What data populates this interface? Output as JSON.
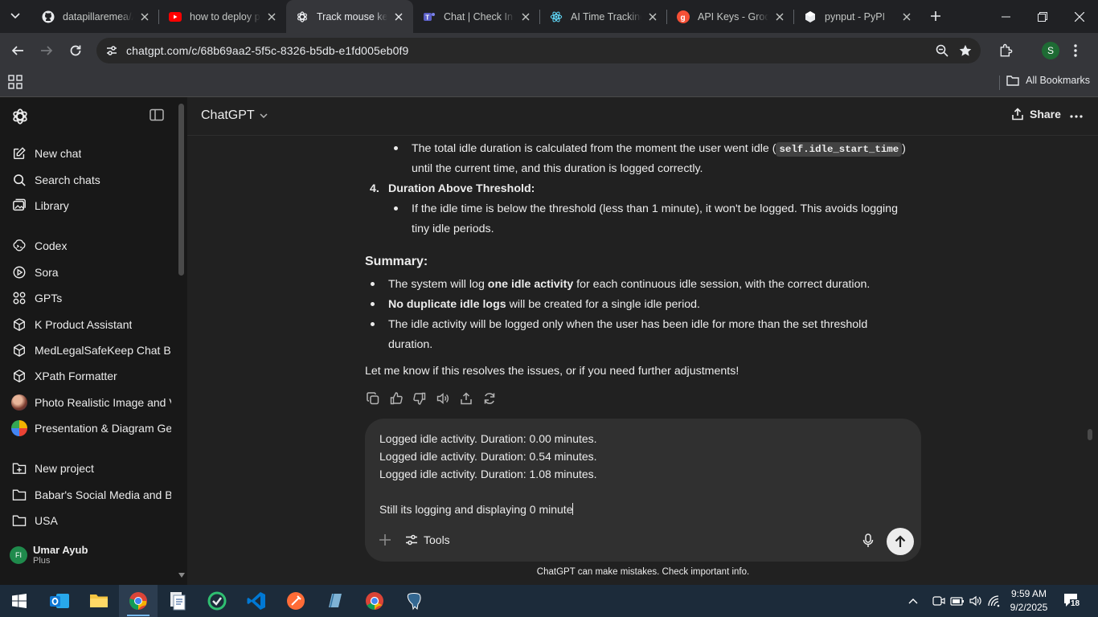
{
  "browser": {
    "tabs": [
      {
        "title": "datapillaremea/AI",
        "favicon": "github-icon"
      },
      {
        "title": "how to deploy python",
        "favicon": "youtube-icon"
      },
      {
        "title": "Track mouse keyboard",
        "favicon": "chatgpt-icon",
        "active": true
      },
      {
        "title": "Chat | Check In | Tasks",
        "favicon": "teams-icon"
      },
      {
        "title": "AI Time Tracking",
        "favicon": "react-icon"
      },
      {
        "title": "API Keys - GroqCloud",
        "favicon": "groq-icon"
      },
      {
        "title": "pynput - PyPI",
        "favicon": "pypi-icon"
      }
    ],
    "url": "chatgpt.com/c/68b69aa2-5f5c-8326-b5db-e1fd005eb0f9",
    "profile_initial": "S",
    "bookmarks_label": "All Bookmarks"
  },
  "sidebar": {
    "nav": [
      {
        "label": "New chat",
        "icon": "new-chat-icon"
      },
      {
        "label": "Search chats",
        "icon": "search-icon"
      },
      {
        "label": "Library",
        "icon": "library-icon"
      }
    ],
    "apps": [
      {
        "label": "Codex",
        "icon": "codex-icon"
      },
      {
        "label": "Sora",
        "icon": "sora-icon"
      },
      {
        "label": "GPTs",
        "icon": "gpts-icon"
      }
    ],
    "gpts": [
      {
        "label": "K Product Assistant",
        "icon": "cube-icon"
      },
      {
        "label": "MedLegalSafeKeep Chat Bot",
        "icon": "cube-icon"
      },
      {
        "label": "XPath Formatter",
        "icon": "cube-icon"
      },
      {
        "label": "Photo Realistic Image and Video Generator",
        "icon": "gpt-avatar"
      },
      {
        "label": "Presentation & Diagram Generator",
        "icon": "gpt-avatar"
      }
    ],
    "projects": [
      {
        "label": "New project",
        "icon": "new-folder-icon"
      },
      {
        "label": "Babar's Social Media and Branding",
        "icon": "folder-icon"
      },
      {
        "label": "USA",
        "icon": "folder-icon"
      }
    ],
    "user": {
      "name": "Umar Ayub",
      "plan": "Plus",
      "initials": "FI"
    }
  },
  "header": {
    "model": "ChatGPT",
    "share": "Share"
  },
  "message": {
    "bullet1_a": "The total idle duration is calculated from the moment the user went idle (",
    "bullet1_code": "self.idle_start_time",
    "bullet1_b": ")",
    "bullet1_c": "until the current time, and this duration is logged correctly.",
    "item4_num": "4.",
    "item4_title": "Duration Above Threshold:",
    "bullet2_a": "If the idle time is below the threshold (less than 1 minute), it won't be logged. This avoids logging",
    "bullet2_b": "tiny idle periods.",
    "summary_heading": "Summary:",
    "sum1_a": "The system will log ",
    "sum1_b": "one idle activity",
    "sum1_c": " for each continuous idle session, with the correct duration.",
    "sum2_a": "No duplicate idle logs",
    "sum2_b": " will be created for a single idle period.",
    "sum3_a": "The idle activity will be logged only when the user has been idle for more than the set threshold",
    "sum3_b": "duration.",
    "closing": "Let me know if this resolves the issues, or if you need further adjustments!"
  },
  "composer": {
    "lines": [
      "Logged idle activity. Duration: 0.00 minutes.",
      "Logged idle activity. Duration: 0.54 minutes.",
      "Logged idle activity. Duration: 1.08 minutes.",
      "",
      "Still its logging and displaying 0 minute"
    ],
    "tools_label": "Tools",
    "disclaimer": "ChatGPT can make mistakes. Check important info."
  },
  "taskbar": {
    "time": "9:59 AM",
    "date": "9/2/2025",
    "notifications": "18"
  }
}
